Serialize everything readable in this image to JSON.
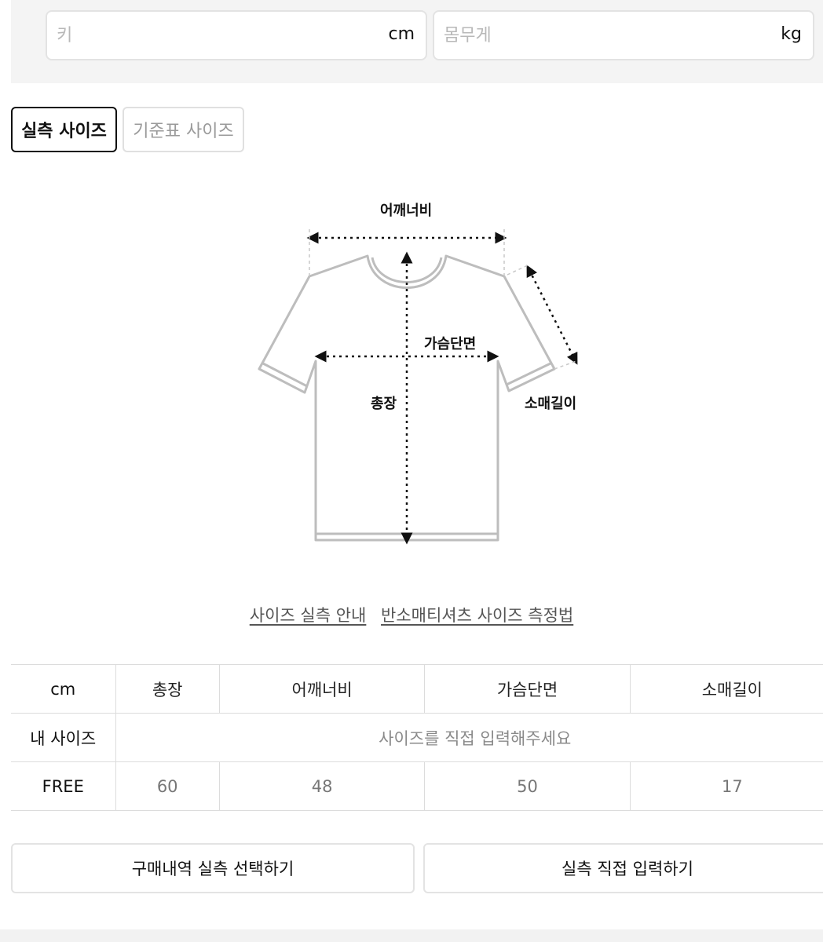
{
  "inputs": {
    "height": {
      "placeholder": "키",
      "unit": "cm"
    },
    "weight": {
      "placeholder": "몸무게",
      "unit": "kg"
    }
  },
  "tabs": [
    {
      "label": "실측 사이즈",
      "active": true
    },
    {
      "label": "기준표 사이즈",
      "active": false
    }
  ],
  "diagram": {
    "shoulder_label": "어깨너비",
    "chest_label": "가슴단면",
    "length_label": "총장",
    "sleeve_label": "소매길이",
    "garment_icon": "tshirt-outline-icon"
  },
  "links": {
    "guide": "사이즈 실측 안내",
    "method": "반소매티셔츠 사이즈 측정법"
  },
  "table": {
    "headers": [
      "cm",
      "총장",
      "어깨너비",
      "가슴단면",
      "소매길이"
    ],
    "my_size_label": "내 사이즈",
    "my_size_hint": "사이즈를 직접 입력해주세요",
    "rows": [
      {
        "size": "FREE",
        "values": [
          "60",
          "48",
          "50",
          "17"
        ]
      }
    ]
  },
  "buttons": {
    "select_history": "구매내역 실측 선택하기",
    "direct_input": "실측 직접 입력하기"
  },
  "colors": {
    "active_border": "#111111",
    "inactive_border": "#e0e0e0",
    "panel_bg": "#f4f4f4"
  }
}
